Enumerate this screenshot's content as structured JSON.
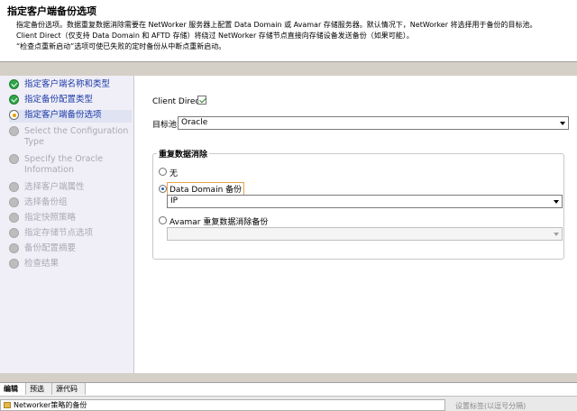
{
  "header": {
    "title": "指定客户端备份选项",
    "lines": [
      "指定备份选项。数据重复数据消除需要在 NetWorker 服务器上配置 Data Domain 或 Avamar 存储服务器。默认情况下，NetWorker 将选择用于备份的目标池。",
      "Client Direct（仅支持 Data Domain 和 AFTD 存储）将绕过 NetWorker 存储节点直接向存储设备发送备份（如果可能）。",
      "“检查点重新启动”选项可使已失败的定时备份从中断点重新启动。"
    ]
  },
  "nav": {
    "items": [
      {
        "label": "指定客户端名称和类型",
        "state": "done"
      },
      {
        "label": "指定备份配置类型",
        "state": "done"
      },
      {
        "label": "指定客户端备份选项",
        "state": "current"
      },
      {
        "label": "Select the Configuration Type",
        "state": "pending"
      },
      {
        "label": "Specify the Oracle Information",
        "state": "pending"
      },
      {
        "label": "选择客户端属性",
        "state": "pending"
      },
      {
        "label": "选择备份组",
        "state": "pending"
      },
      {
        "label": "指定快照策略",
        "state": "pending"
      },
      {
        "label": "指定存储节点选项",
        "state": "pending"
      },
      {
        "label": "备份配置摘要",
        "state": "pending"
      },
      {
        "label": "检查结果",
        "state": "pending"
      }
    ]
  },
  "form": {
    "client_direct_label": "Client Direct:",
    "client_direct_checked": true,
    "target_pool_label": "目标池:",
    "target_pool_value": "Oracle",
    "dedup": {
      "group_title": "重复数据消除",
      "option_none": "无",
      "option_datadomain": "Data Domain 备份",
      "datadomain_value": "IP",
      "option_avamar": "Avamar 重复数据消除备份",
      "avamar_value": "",
      "selected": "datadomain"
    }
  },
  "tabs": [
    "编辑",
    "预选",
    "源代码"
  ],
  "status_bar": {
    "field_text": "Networker策略的备份",
    "note": "设置标签(以逗号分隔)"
  },
  "colors": {
    "nav_link": "#1d3aa8",
    "nav_pending": "#a9a9b3",
    "body_bg": "#d4d0c8",
    "nav_bg": "#f0eff7",
    "done_icon": "#2fa84a",
    "focus_border": "#e8a24a"
  }
}
